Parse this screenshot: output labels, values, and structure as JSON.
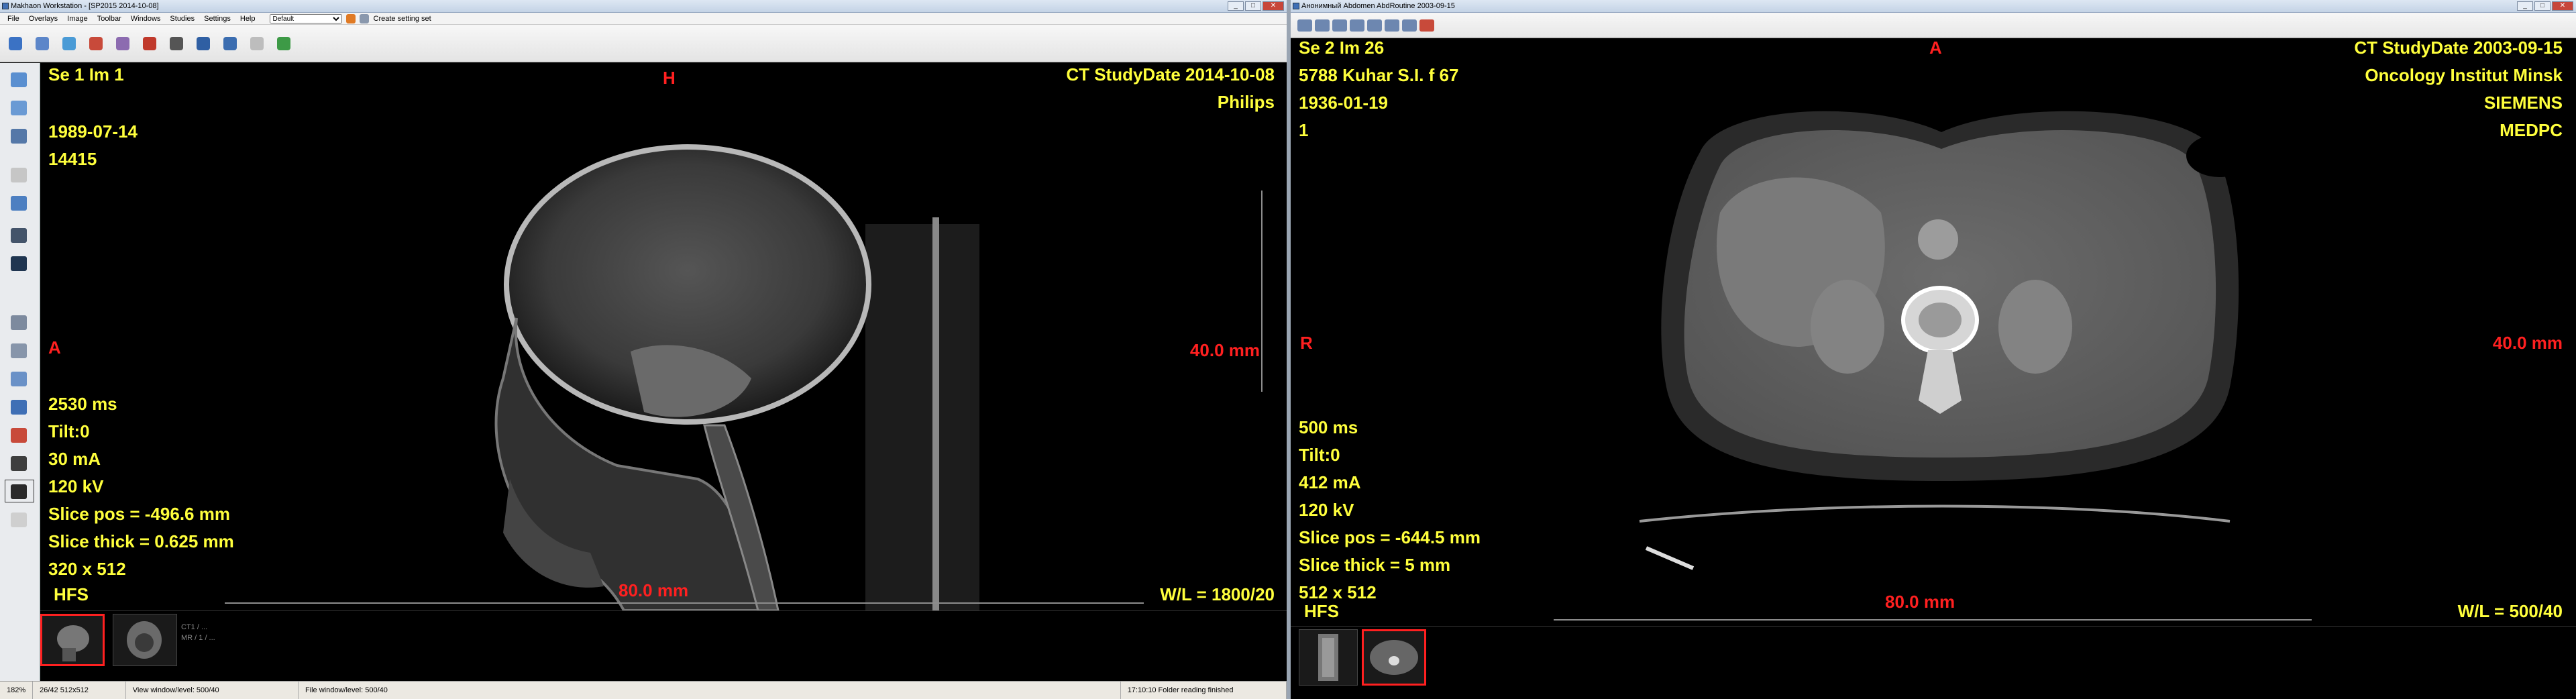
{
  "left_window": {
    "title": "Makhaon Workstation - [SP2015 2014-10-08]",
    "menu": [
      "File",
      "Overlays",
      "Image",
      "Toolbar",
      "Windows",
      "Studies",
      "Settings",
      "Help"
    ],
    "setting_preset": "Default",
    "setting_set_label": "Create setting set",
    "viewer": {
      "top_left": [
        "Se 1 Im 1",
        "",
        "1989-07-14",
        "14415"
      ],
      "top_center": "H",
      "top_right": [
        "CT StudyDate 2014-10-08",
        "Philips"
      ],
      "left_marker": "A",
      "right_scale": "40.0 mm",
      "bottom_left": [
        "2530 ms",
        "Tilt:0",
        "30 mA",
        "120 kV",
        "Slice pos = -496.6 mm",
        "Slice thick = 0.625 mm",
        "320 x 512"
      ],
      "orientation": "HFS",
      "bottom_scale": "80.0 mm",
      "window_level": "W/L = 1800/20"
    },
    "thumb_text": [
      "CT1 / ...",
      "MR / 1 / ..."
    ],
    "status": [
      "182%",
      "26/42 512x512",
      "View window/level: 500/40",
      "File window/level: 500/40",
      "17:10:10 Folder reading finished"
    ]
  },
  "right_window": {
    "title": "Анонимный Abdomen AbdRoutine 2003-09-15",
    "viewer": {
      "top_left": [
        "Se 2 Im 26",
        "5788 Kuhar S.I. f 67",
        "1936-01-19",
        "1"
      ],
      "top_center": "A",
      "top_right": [
        "CT StudyDate 2003-09-15",
        "Oncology Institut Minsk",
        "SIEMENS",
        "MEDPC"
      ],
      "left_marker": "R",
      "right_scale": "40.0 mm",
      "bottom_left": [
        "500 ms",
        "Tilt:0",
        "412 mA",
        "120 kV",
        "Slice pos = -644.5 mm",
        "Slice thick = 5 mm",
        "512 x 512"
      ],
      "orientation": "HFS",
      "bottom_scale": "80.0 mm",
      "window_level": "W/L = 500/40"
    }
  },
  "colors": {
    "overlay_yellow": "#ffff3c",
    "overlay_red": "#ff2020"
  }
}
